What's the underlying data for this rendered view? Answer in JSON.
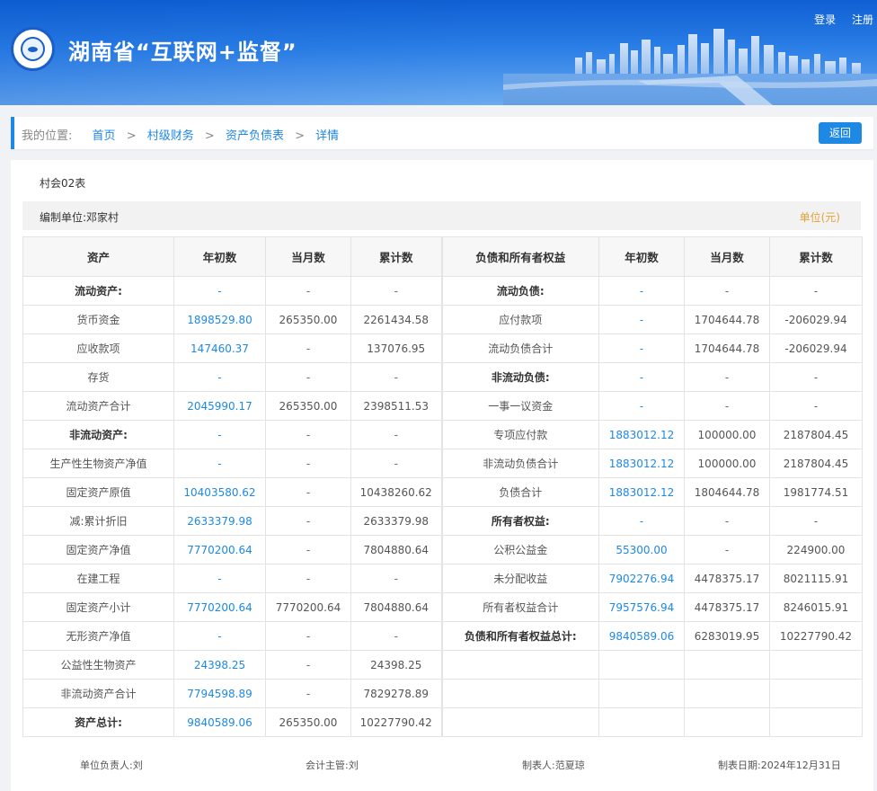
{
  "header": {
    "title": "湖南省“互联网+监督”",
    "login_label": "登录",
    "register_label": "注册"
  },
  "breadcrumb": {
    "prefix": "我的位置:",
    "items": [
      "首页",
      "村级财务",
      "资产负债表",
      "详情"
    ],
    "back_label": "返回"
  },
  "report": {
    "form_code": "村会02表",
    "compiler": "编制单位:邓家村",
    "unit": "单位(元)",
    "headers": [
      "资产",
      "年初数",
      "当月数",
      "累计数",
      "负债和所有者权益",
      "年初数",
      "当月数",
      "累计数"
    ],
    "rows": [
      [
        "流动资产:",
        "-",
        "-",
        "-",
        "流动负债:",
        "-",
        "-",
        "-"
      ],
      [
        "货币资金",
        "1898529.80",
        "265350.00",
        "2261434.58",
        "应付款项",
        "-",
        "1704644.78",
        "-206029.94"
      ],
      [
        "应收款项",
        "147460.37",
        "-",
        "137076.95",
        "流动负债合计",
        "-",
        "1704644.78",
        "-206029.94"
      ],
      [
        "存货",
        "-",
        "-",
        "-",
        "非流动负债:",
        "-",
        "-",
        "-"
      ],
      [
        "流动资产合计",
        "2045990.17",
        "265350.00",
        "2398511.53",
        "一事一议资金",
        "-",
        "-",
        "-"
      ],
      [
        "非流动资产:",
        "-",
        "-",
        "-",
        "专项应付款",
        "1883012.12",
        "100000.00",
        "2187804.45"
      ],
      [
        "生产性生物资产净值",
        "-",
        "-",
        "-",
        "非流动负债合计",
        "1883012.12",
        "100000.00",
        "2187804.45"
      ],
      [
        "固定资产原值",
        "10403580.62",
        "-",
        "10438260.62",
        "负债合计",
        "1883012.12",
        "1804644.78",
        "1981774.51"
      ],
      [
        "减:累计折旧",
        "2633379.98",
        "-",
        "2633379.98",
        "所有者权益:",
        "-",
        "-",
        "-"
      ],
      [
        "固定资产净值",
        "7770200.64",
        "-",
        "7804880.64",
        "公积公益金",
        "55300.00",
        "-",
        "224900.00"
      ],
      [
        "在建工程",
        "-",
        "-",
        "-",
        "未分配收益",
        "7902276.94",
        "4478375.17",
        "8021115.91"
      ],
      [
        "固定资产小计",
        "7770200.64",
        "7770200.64",
        "7804880.64",
        "所有者权益合计",
        "7957576.94",
        "4478375.17",
        "8246015.91"
      ],
      [
        "无形资产净值",
        "-",
        "-",
        "-",
        "负债和所有者权益总计:",
        "9840589.06",
        "6283019.95",
        "10227790.42"
      ],
      [
        "公益性生物资产",
        "24398.25",
        "-",
        "24398.25",
        "",
        "",
        "",
        ""
      ],
      [
        "非流动资产合计",
        "7794598.89",
        "-",
        "7829278.89",
        "",
        "",
        "",
        ""
      ],
      [
        "资产总计:",
        "9840589.06",
        "265350.00",
        "10227790.42",
        "",
        "",
        "",
        ""
      ]
    ],
    "bold_left": [
      0,
      5,
      15
    ],
    "bold_right": [
      0,
      3,
      8,
      12
    ],
    "signatures": {
      "unit_head": "单位负责人:刘",
      "accounting_head": "会计主管:刘",
      "preparer": "制表人:范夏琼",
      "date": "制表日期:2024年12月31日"
    }
  },
  "colors": {
    "accent": "#1e88e5",
    "unit_text": "#e3a336"
  },
  "icons": {
    "logo": "supervision-eye-emblem",
    "banner": "city-skyline"
  }
}
